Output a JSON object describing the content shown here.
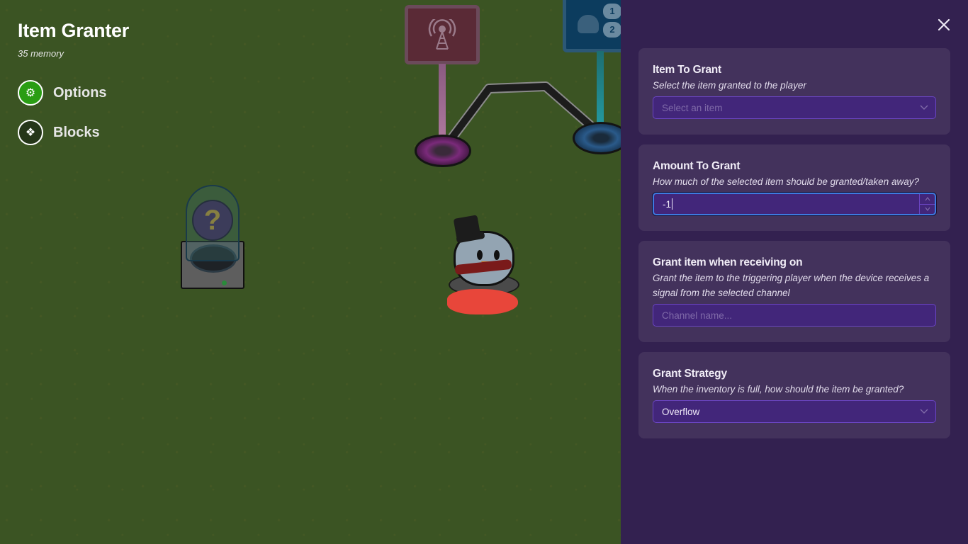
{
  "device": {
    "title": "Item Granter",
    "memory": "35 memory"
  },
  "side_nav": [
    {
      "label": "Options",
      "icon": "gear-icon",
      "active": true
    },
    {
      "label": "Blocks",
      "icon": "blocks-icon",
      "active": false
    }
  ],
  "icons": {
    "gear": "⚙",
    "blocks": "❖",
    "close": "✕",
    "question": "?",
    "stepper_up": "▲",
    "stepper_down": "▼"
  },
  "panel": {
    "sections": [
      {
        "title": "Item To Grant",
        "description": "Select the item granted to the player",
        "type": "select",
        "value": "",
        "placeholder": "Select an item"
      },
      {
        "title": "Amount To Grant",
        "description": "How much of the selected item should be granted/taken away?",
        "type": "number",
        "value": "-1",
        "placeholder": ""
      },
      {
        "title": "Grant item when receiving on",
        "description": "Grant the item to the triggering player when the device receives a signal from the selected channel",
        "type": "text",
        "value": "",
        "placeholder": "Channel name..."
      },
      {
        "title": "Grant Strategy",
        "description": "When the inventory is full, how should the item be granted?",
        "type": "select",
        "value": "Overflow",
        "placeholder": ""
      }
    ]
  },
  "sign_counters": [
    "1",
    "2"
  ],
  "colors": {
    "panel_bg": "#332150",
    "card_bg": "#43325c",
    "field_bg": "#42267a",
    "field_border": "#6a45c2",
    "focus_border": "#3d7ae0",
    "active_nav": "#2a9d14",
    "grass": "#3b5423"
  }
}
